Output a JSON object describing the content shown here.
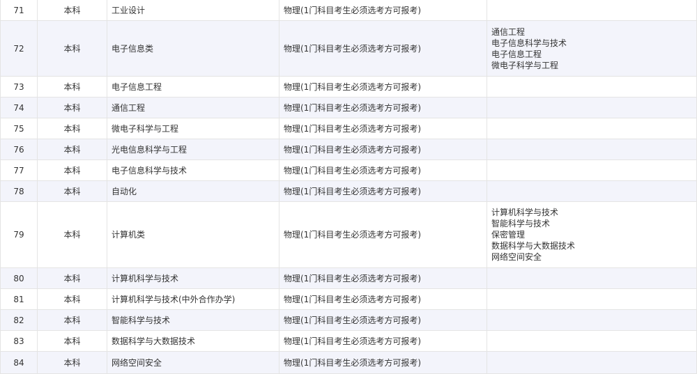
{
  "rows": [
    {
      "num": "71",
      "level": "本科",
      "major": "工业设计",
      "req": "物理(1门科目考生必须选考方可报考)",
      "sub": []
    },
    {
      "num": "72",
      "level": "本科",
      "major": "电子信息类",
      "req": "物理(1门科目考生必须选考方可报考)",
      "sub": [
        "通信工程",
        "电子信息科学与技术",
        "电子信息工程",
        "微电子科学与工程"
      ]
    },
    {
      "num": "73",
      "level": "本科",
      "major": "电子信息工程",
      "req": "物理(1门科目考生必须选考方可报考)",
      "sub": []
    },
    {
      "num": "74",
      "level": "本科",
      "major": "通信工程",
      "req": "物理(1门科目考生必须选考方可报考)",
      "sub": []
    },
    {
      "num": "75",
      "level": "本科",
      "major": "微电子科学与工程",
      "req": "物理(1门科目考生必须选考方可报考)",
      "sub": []
    },
    {
      "num": "76",
      "level": "本科",
      "major": "光电信息科学与工程",
      "req": "物理(1门科目考生必须选考方可报考)",
      "sub": []
    },
    {
      "num": "77",
      "level": "本科",
      "major": "电子信息科学与技术",
      "req": "物理(1门科目考生必须选考方可报考)",
      "sub": []
    },
    {
      "num": "78",
      "level": "本科",
      "major": "自动化",
      "req": "物理(1门科目考生必须选考方可报考)",
      "sub": []
    },
    {
      "num": "79",
      "level": "本科",
      "major": "计算机类",
      "req": "物理(1门科目考生必须选考方可报考)",
      "sub": [
        "计算机科学与技术",
        "智能科学与技术",
        "保密管理",
        "数据科学与大数据技术",
        "网络空间安全"
      ]
    },
    {
      "num": "80",
      "level": "本科",
      "major": "计算机科学与技术",
      "req": "物理(1门科目考生必须选考方可报考)",
      "sub": []
    },
    {
      "num": "81",
      "level": "本科",
      "major": "计算机科学与技术(中外合作办学)",
      "req": "物理(1门科目考生必须选考方可报考)",
      "sub": []
    },
    {
      "num": "82",
      "level": "本科",
      "major": "智能科学与技术",
      "req": "物理(1门科目考生必须选考方可报考)",
      "sub": []
    },
    {
      "num": "83",
      "level": "本科",
      "major": "数据科学与大数据技术",
      "req": "物理(1门科目考生必须选考方可报考)",
      "sub": []
    },
    {
      "num": "84",
      "level": "本科",
      "major": "网络空间安全",
      "req": "物理(1门科目考生必须选考方可报考)",
      "sub": []
    }
  ]
}
